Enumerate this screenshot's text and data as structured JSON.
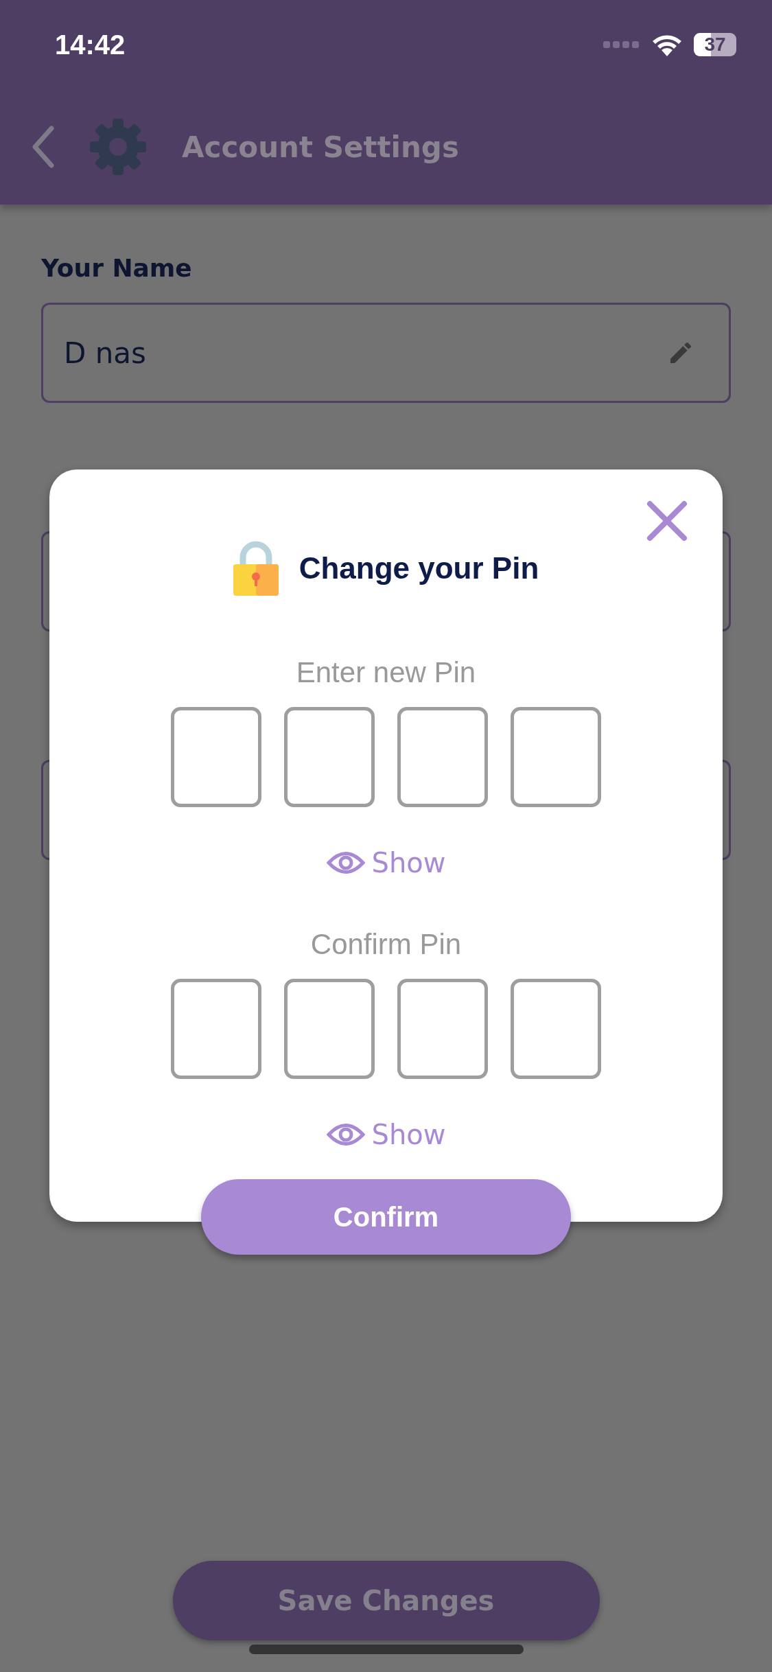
{
  "status_bar": {
    "time": "14:42",
    "battery": "37"
  },
  "header": {
    "title": "Account Settings"
  },
  "fields": [
    {
      "label": "Your Name",
      "value": "D nas"
    }
  ],
  "dialog": {
    "title": "Change your Pin",
    "sections": [
      {
        "label": "Enter new Pin",
        "toggle": "Show"
      },
      {
        "label": "Confirm Pin",
        "toggle": "Show"
      }
    ],
    "confirm_button": "Confirm"
  },
  "save_button": "Save Changes"
}
